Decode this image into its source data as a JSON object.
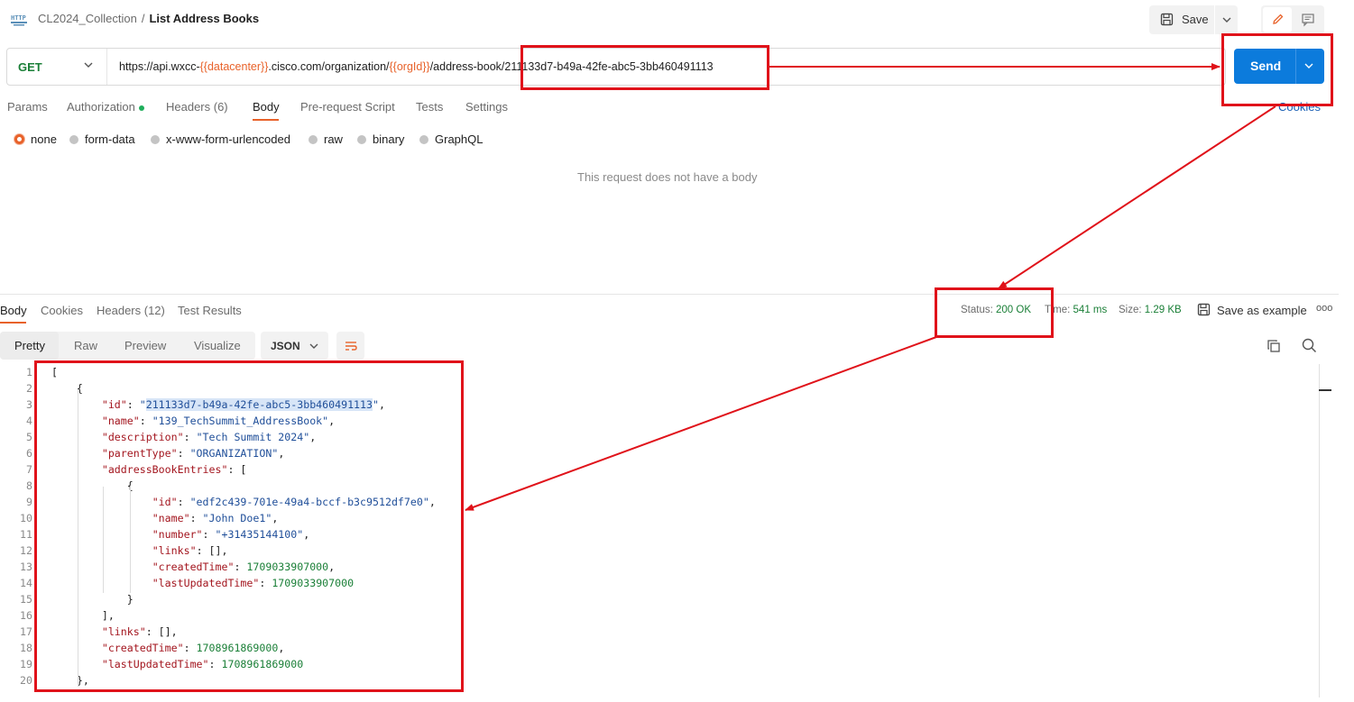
{
  "header": {
    "collection": "CL2024_Collection",
    "separator": "/",
    "request_name": "List Address Books",
    "save_label": "Save"
  },
  "request": {
    "method": "GET",
    "url_prefix": "https://api.wxcc-",
    "url_var1": "{{datacenter}}",
    "url_mid": ".cisco.com/organization/",
    "url_var2": "{{orgId}}",
    "url_path": "/address-book/",
    "url_id": "211133d7-b49a-42fe-abc5-3bb460491113",
    "send_label": "Send"
  },
  "request_tabs": [
    {
      "label": "Params"
    },
    {
      "label": "Authorization"
    },
    {
      "label": "Headers (6)"
    },
    {
      "label": "Body"
    },
    {
      "label": "Pre-request Script"
    },
    {
      "label": "Tests"
    },
    {
      "label": "Settings"
    }
  ],
  "cookies_label": "Cookies",
  "body_types": [
    "none",
    "form-data",
    "x-www-form-urlencoded",
    "raw",
    "binary",
    "GraphQL"
  ],
  "body_selected": "none",
  "no_body_message": "This request does not have a body",
  "response": {
    "tabs": [
      "Body",
      "Cookies",
      "Headers (12)",
      "Test Results"
    ],
    "status_label": "Status:",
    "status_value": "200 OK",
    "time_label": "Time:",
    "time_value": "541 ms",
    "size_label": "Size:",
    "size_value": "1.29 KB",
    "save_example_label": "Save as example",
    "more_label": "ooo",
    "view_tabs": [
      "Pretty",
      "Raw",
      "Preview",
      "Visualize"
    ],
    "format": "JSON"
  },
  "code_lines": [
    {
      "n": "1",
      "text": "["
    },
    {
      "n": "2",
      "text": "    {"
    },
    {
      "n": "3",
      "text": "        \"id\": \"211133d7-b49a-42fe-abc5-3bb460491113\","
    },
    {
      "n": "4",
      "text": "        \"name\": \"139_TechSummit_AddressBook\","
    },
    {
      "n": "5",
      "text": "        \"description\": \"Tech Summit 2024\","
    },
    {
      "n": "6",
      "text": "        \"parentType\": \"ORGANIZATION\","
    },
    {
      "n": "7",
      "text": "        \"addressBookEntries\": ["
    },
    {
      "n": "8",
      "text": "            {"
    },
    {
      "n": "9",
      "text": "                \"id\": \"edf2c439-701e-49a4-bccf-b3c9512df7e0\","
    },
    {
      "n": "10",
      "text": "                \"name\": \"John Doe1\","
    },
    {
      "n": "11",
      "text": "                \"number\": \"+31435144100\","
    },
    {
      "n": "12",
      "text": "                \"links\": [],"
    },
    {
      "n": "13",
      "text": "                \"createdTime\": 1709033907000,"
    },
    {
      "n": "14",
      "text": "                \"lastUpdatedTime\": 1709033907000"
    },
    {
      "n": "15",
      "text": "            }"
    },
    {
      "n": "16",
      "text": "        ],"
    },
    {
      "n": "17",
      "text": "        \"links\": [],"
    },
    {
      "n": "18",
      "text": "        \"createdTime\": 1708961869000,"
    },
    {
      "n": "19",
      "text": "        \"lastUpdatedTime\": 1708961869000"
    },
    {
      "n": "20",
      "text": "    },"
    }
  ],
  "colors": {
    "accent": "#e8622a",
    "send_button": "#0c7bdc",
    "annotation_red": "#e0121a",
    "status_green": "#1a7f37"
  }
}
